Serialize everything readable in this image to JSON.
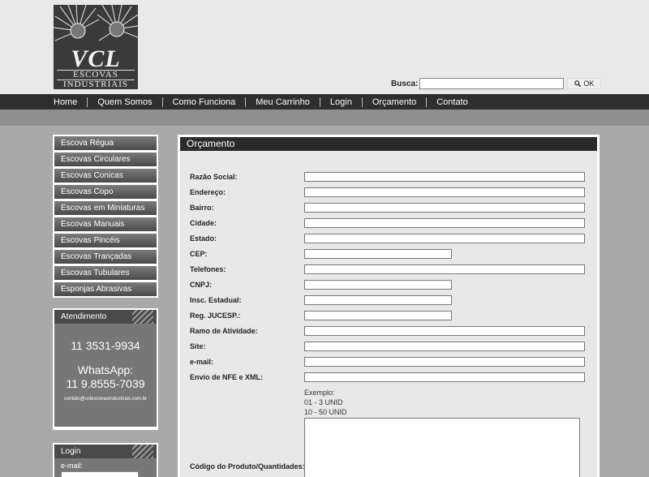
{
  "brand": {
    "logo_main": "VCL",
    "logo_sub1": "ESCOVAS",
    "logo_sub2": "INDUSTRIAIS"
  },
  "search": {
    "label": "Busca:",
    "value": "",
    "button_label": "OK",
    "button_icon": "search-icon"
  },
  "nav": {
    "items": [
      {
        "label": "Home"
      },
      {
        "label": "Quem Somos"
      },
      {
        "label": "Como Funciona"
      },
      {
        "label": "Meu Carrinho"
      },
      {
        "label": "Login"
      },
      {
        "label": "Orçamento"
      },
      {
        "label": "Contato"
      }
    ]
  },
  "sidebar": {
    "items": [
      {
        "label": "Escova Régua"
      },
      {
        "label": "Escovas Circulares"
      },
      {
        "label": "Escovas Conicas"
      },
      {
        "label": "Escovas Copo"
      },
      {
        "label": "Escovas em Miniaturas"
      },
      {
        "label": "Escovas Manuais"
      },
      {
        "label": "Escovas Pincéis"
      },
      {
        "label": "Escovas Trançadas"
      },
      {
        "label": "Escovas Tubulares"
      },
      {
        "label": "Esponjas Abrasivas"
      }
    ]
  },
  "atendimento": {
    "title": "Atendimento",
    "phone": "11 3531-9934",
    "whatsapp_label": "WhatsApp:",
    "whatsapp_phone": "11 9.8555-7039",
    "email": "contato@vclescovasindustriais.com.br"
  },
  "login_box": {
    "title": "Login",
    "email_label": "e-mail:"
  },
  "form": {
    "title": "Orçamento",
    "fields": [
      {
        "label": "Razão Social:",
        "value": ""
      },
      {
        "label": "Endereço:",
        "value": ""
      },
      {
        "label": "Bairro:",
        "value": ""
      },
      {
        "label": "Cidade:",
        "value": ""
      },
      {
        "label": "Estado:",
        "value": ""
      },
      {
        "label": "CEP:",
        "value": ""
      },
      {
        "label": "Telefones:",
        "value": ""
      },
      {
        "label": "CNPJ:",
        "value": ""
      },
      {
        "label": "Insc. Estadual:",
        "value": ""
      },
      {
        "label": "Reg. JUCESP.:",
        "value": ""
      },
      {
        "label": "Ramo de Atividade:",
        "value": ""
      },
      {
        "label": "Site:",
        "value": ""
      },
      {
        "label": "e-mail:",
        "value": ""
      },
      {
        "label": "Envio de NFE e XML:",
        "value": ""
      }
    ],
    "example_title": "Exemplo:",
    "example_line1": "01 - 3 UNID",
    "example_line2": "10 - 50 UNID",
    "products_label": "Código do Produto/Quantidades:"
  }
}
